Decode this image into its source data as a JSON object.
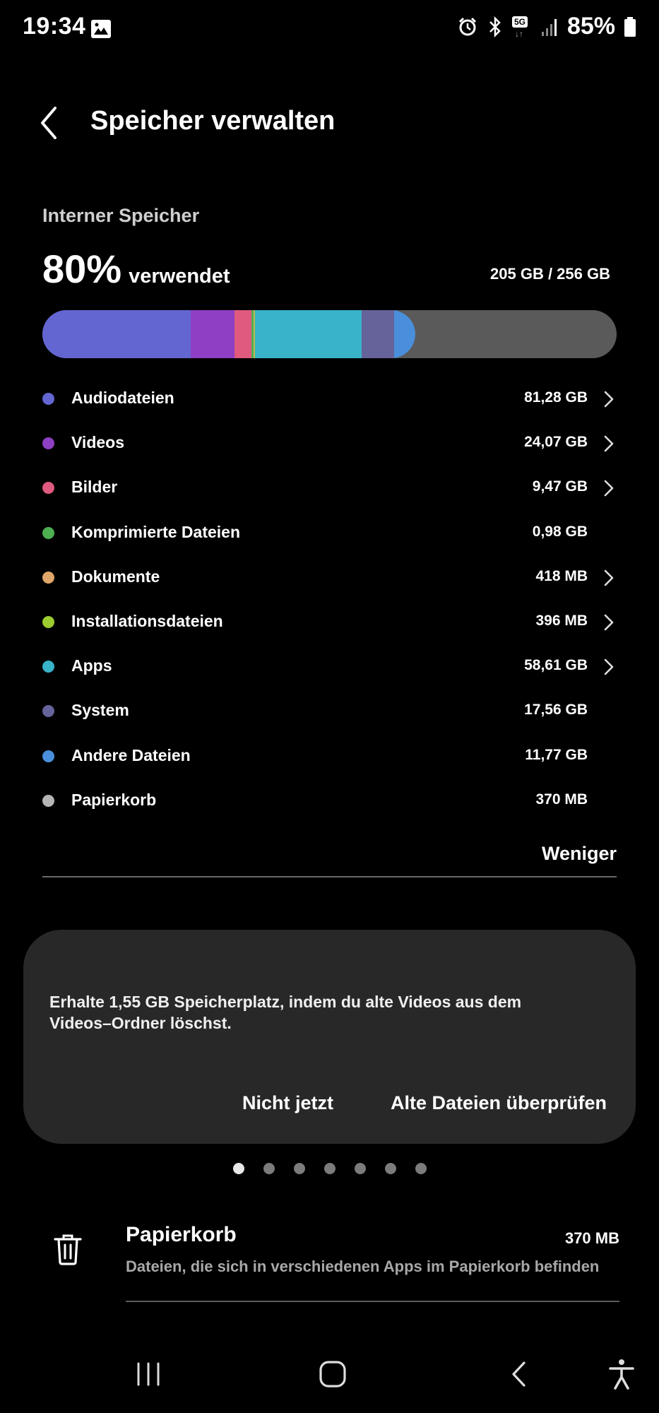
{
  "status_bar": {
    "time": "19:34",
    "network": "5G",
    "battery": "85%",
    "icons": [
      "gallery-icon",
      "alarm-icon",
      "bluetooth-icon",
      "5g-icon",
      "signal-icon",
      "battery-icon"
    ]
  },
  "header": {
    "title": "Speicher verwalten",
    "back_icon": "back-arrow-icon"
  },
  "storage": {
    "section_label": "Interner Speicher",
    "used_percent": "80%",
    "used_label": "verwendet",
    "used_total": "205 GB / 256 GB",
    "used_fraction": 0.8,
    "bar_background_color": "#5a5a5a"
  },
  "categories": [
    {
      "name": "Audiodateien",
      "size": "81,28 GB",
      "color": "#6366d1",
      "chevron": true
    },
    {
      "name": "Videos",
      "size": "24,07 GB",
      "color": "#8e3fc3",
      "chevron": true
    },
    {
      "name": "Bilder",
      "size": "9,47 GB",
      "color": "#df5a7d",
      "chevron": true
    },
    {
      "name": "Komprimierte Dateien",
      "size": "0,98 GB",
      "color": "#4caf50",
      "chevron": false
    },
    {
      "name": "Dokumente",
      "size": "418 MB",
      "color": "#e0a66a",
      "chevron": true
    },
    {
      "name": "Installationsdateien",
      "size": "396 MB",
      "color": "#9ccc2f",
      "chevron": true
    },
    {
      "name": "Apps",
      "size": "58,61 GB",
      "color": "#38b3c8",
      "chevron": true
    },
    {
      "name": "System",
      "size": "17,56 GB",
      "color": "#66639a",
      "chevron": false
    },
    {
      "name": "Andere Dateien",
      "size": "11,77 GB",
      "color": "#4a8fdb",
      "chevron": false
    },
    {
      "name": "Papierkorb",
      "size": "370 MB",
      "color": "#b5b5b5",
      "chevron": false
    }
  ],
  "less_button": "Weniger",
  "suggestion_card": {
    "text": "Erhalte 1,55 GB Speicherplatz, indem du alte Videos aus dem Videos–Ordner löschst.",
    "dismiss_label": "Nicht jetzt",
    "action_label": "Alte Dateien überprüfen",
    "page_count": 7,
    "active_page": 1
  },
  "recycle_bin": {
    "title": "Papierkorb",
    "size": "370 MB",
    "description": "Dateien, die sich in verschiedenen Apps im Papierkorb befinden",
    "icon": "trash-icon"
  },
  "nav_bar": {
    "icons": [
      "recents-icon",
      "home-icon",
      "back-icon",
      "accessibility-icon"
    ]
  }
}
